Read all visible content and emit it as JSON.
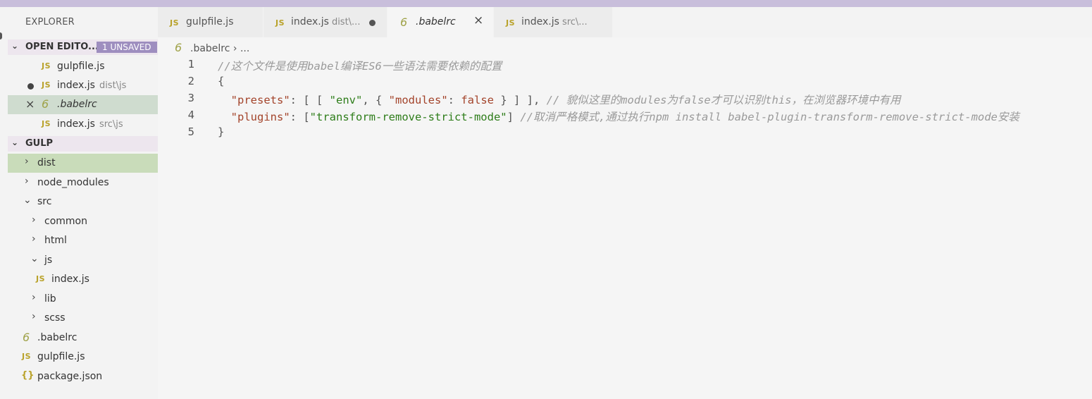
{
  "sidebar": {
    "title": "EXPLORER",
    "open_editors": {
      "header": "OPEN EDITO...",
      "badge": "1 UNSAVED",
      "items": [
        {
          "icon": "JS",
          "label": "gulpfile.js",
          "desc": ""
        },
        {
          "icon": "JS",
          "label": "index.js",
          "desc": "dist\\js"
        },
        {
          "icon": "6",
          "label": ".babelrc",
          "desc": ""
        },
        {
          "icon": "JS",
          "label": "index.js",
          "desc": "src\\js"
        }
      ]
    },
    "gulp": {
      "header": "GULP",
      "tree": [
        {
          "label": "dist"
        },
        {
          "label": "node_modules"
        },
        {
          "label": "src"
        },
        {
          "label": "common"
        },
        {
          "label": "html"
        },
        {
          "label": "js"
        },
        {
          "label": "index.js",
          "icon": "JS"
        },
        {
          "label": "lib"
        },
        {
          "label": "scss"
        },
        {
          "label": ".babelrc",
          "icon": "6"
        },
        {
          "label": "gulpfile.js",
          "icon": "JS"
        },
        {
          "label": "package.json",
          "icon": "{}"
        }
      ]
    }
  },
  "tabs": [
    {
      "icon": "JS",
      "label": "gulpfile.js",
      "desc": ""
    },
    {
      "icon": "JS",
      "label": "index.js",
      "desc": "dist\\..."
    },
    {
      "icon": "6",
      "label": ".babelrc",
      "desc": ""
    },
    {
      "icon": "JS",
      "label": "index.js",
      "desc": "src\\..."
    }
  ],
  "icons": {
    "close": "×",
    "chevron_right": "›",
    "chevron_down": "⌄"
  },
  "breadcrumb": {
    "file": ".babelrc",
    "sep": "›",
    "more": "..."
  },
  "editor": {
    "line_numbers": [
      "1",
      "2",
      "3",
      "4",
      "5"
    ],
    "line1_comment": "//这个文件是使用babel编译ES6一些语法需要依赖的配置",
    "line2_brace": "{",
    "line3": {
      "indent": "  ",
      "key": "\"presets\"",
      "p1": ": [ [ ",
      "str1": "\"env\"",
      "p2": ", { ",
      "key2": "\"modules\"",
      "p3": ": ",
      "val": "false",
      "p4": " } ] ], ",
      "comment": "// 貌似这里的modules为false才可以识别this，在浏览器环境中有用"
    },
    "line4": {
      "indent": "  ",
      "key": "\"plugins\"",
      "p1": ": [",
      "str": "\"transform-remove-strict-mode\"",
      "p2": "] ",
      "comment": "//取消严格模式,通过执行npm install babel-plugin-transform-remove-strict-mode安装"
    },
    "line5_brace": "}"
  },
  "colors": {
    "accent_badge": "#9e8ebf",
    "selection_green": "#c9dcba",
    "js_icon": "#b9a22a",
    "babel_icon": "#a0a34a",
    "string": "#2e7d1a",
    "key": "#a3432a",
    "comment": "#9a9a9a"
  }
}
